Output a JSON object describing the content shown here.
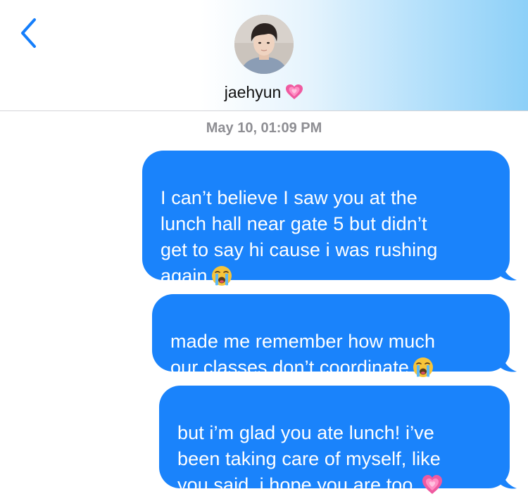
{
  "header": {
    "contact_name": "jaehyun",
    "name_emoji": "growing-heart-icon",
    "back_icon": "chevron-left-icon"
  },
  "thread": {
    "timestamp": "May 10, 01:09 PM",
    "messages": [
      {
        "text": "I can’t believe I saw you at the\nlunch hall near gate 5 but didn’t\nget to say hi cause i was rushing\nagain",
        "emoji": "loudly-crying-face-icon"
      },
      {
        "text": "made me remember how much\nour classes don’t coordinate",
        "emoji": "loudly-crying-face-icon"
      },
      {
        "text": "but i’m glad you ate lunch! i’ve\nbeen taking care of myself, like\nyou said. i hope you are too.",
        "emoji": "growing-heart-icon"
      }
    ]
  },
  "colors": {
    "bubble": "#1a83fb",
    "accent": "#147efb",
    "timestamp": "#8e8e93"
  }
}
